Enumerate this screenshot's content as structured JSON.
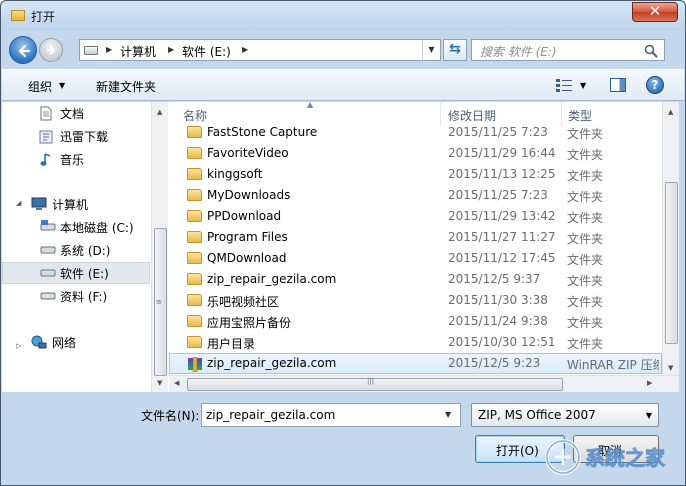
{
  "window": {
    "title": "打开",
    "close_glyph": "✕"
  },
  "nav": {
    "breadcrumbs": [
      "计算机",
      "软件 (E:)"
    ],
    "search_placeholder": "搜索 软件 (E:)"
  },
  "toolbar": {
    "organize_label": "组织",
    "new_folder_label": "新建文件夹",
    "help_glyph": "?"
  },
  "sidebar": {
    "items": [
      {
        "label": "文档",
        "icon": "document-icon"
      },
      {
        "label": "迅雷下载",
        "icon": "download-icon"
      },
      {
        "label": "音乐",
        "icon": "music-icon"
      },
      {
        "label": "计算机",
        "icon": "computer-icon"
      },
      {
        "label": "本地磁盘 (C:)",
        "icon": "drive-icon"
      },
      {
        "label": "系统 (D:)",
        "icon": "drive-icon"
      },
      {
        "label": "软件 (E:)",
        "icon": "drive-icon",
        "selected": true
      },
      {
        "label": "资料 (F:)",
        "icon": "drive-icon"
      },
      {
        "label": "网络",
        "icon": "network-icon"
      }
    ]
  },
  "filelist": {
    "columns": [
      "名称",
      "修改日期",
      "类型"
    ],
    "rows": [
      {
        "name": "FastStone Capture",
        "date": "2015/11/25 7:23",
        "type": "文件夹",
        "kind": "folder"
      },
      {
        "name": "FavoriteVideo",
        "date": "2015/11/29 16:44",
        "type": "文件夹",
        "kind": "folder"
      },
      {
        "name": "kinggsoft",
        "date": "2015/11/13 12:25",
        "type": "文件夹",
        "kind": "folder"
      },
      {
        "name": "MyDownloads",
        "date": "2015/11/25 7:23",
        "type": "文件夹",
        "kind": "folder"
      },
      {
        "name": "PPDownload",
        "date": "2015/11/29 13:42",
        "type": "文件夹",
        "kind": "folder"
      },
      {
        "name": "Program Files",
        "date": "2015/11/27 11:27",
        "type": "文件夹",
        "kind": "folder"
      },
      {
        "name": "QMDownload",
        "date": "2015/11/12 17:45",
        "type": "文件夹",
        "kind": "folder"
      },
      {
        "name": "zip_repair_gezila.com",
        "date": "2015/12/5 9:37",
        "type": "文件夹",
        "kind": "folder"
      },
      {
        "name": "乐吧视频社区",
        "date": "2015/11/30 3:38",
        "type": "文件夹",
        "kind": "folder"
      },
      {
        "name": "应用宝照片备份",
        "date": "2015/11/24 9:38",
        "type": "文件夹",
        "kind": "folder"
      },
      {
        "name": "用户目录",
        "date": "2015/10/30 12:51",
        "type": "文件夹",
        "kind": "folder"
      },
      {
        "name": "zip_repair_gezila.com",
        "date": "2015/12/5 9:23",
        "type": "WinRAR ZIP 压缩",
        "kind": "rar",
        "selected": true
      }
    ]
  },
  "footer": {
    "filename_label": "文件名(N):",
    "filename_value": "zip_repair_gezila.com",
    "filetype_value": "ZIP, MS Office 2007",
    "open_label": "打开(O)",
    "cancel_label": "取消"
  },
  "watermark": {
    "text": "系统之家"
  }
}
